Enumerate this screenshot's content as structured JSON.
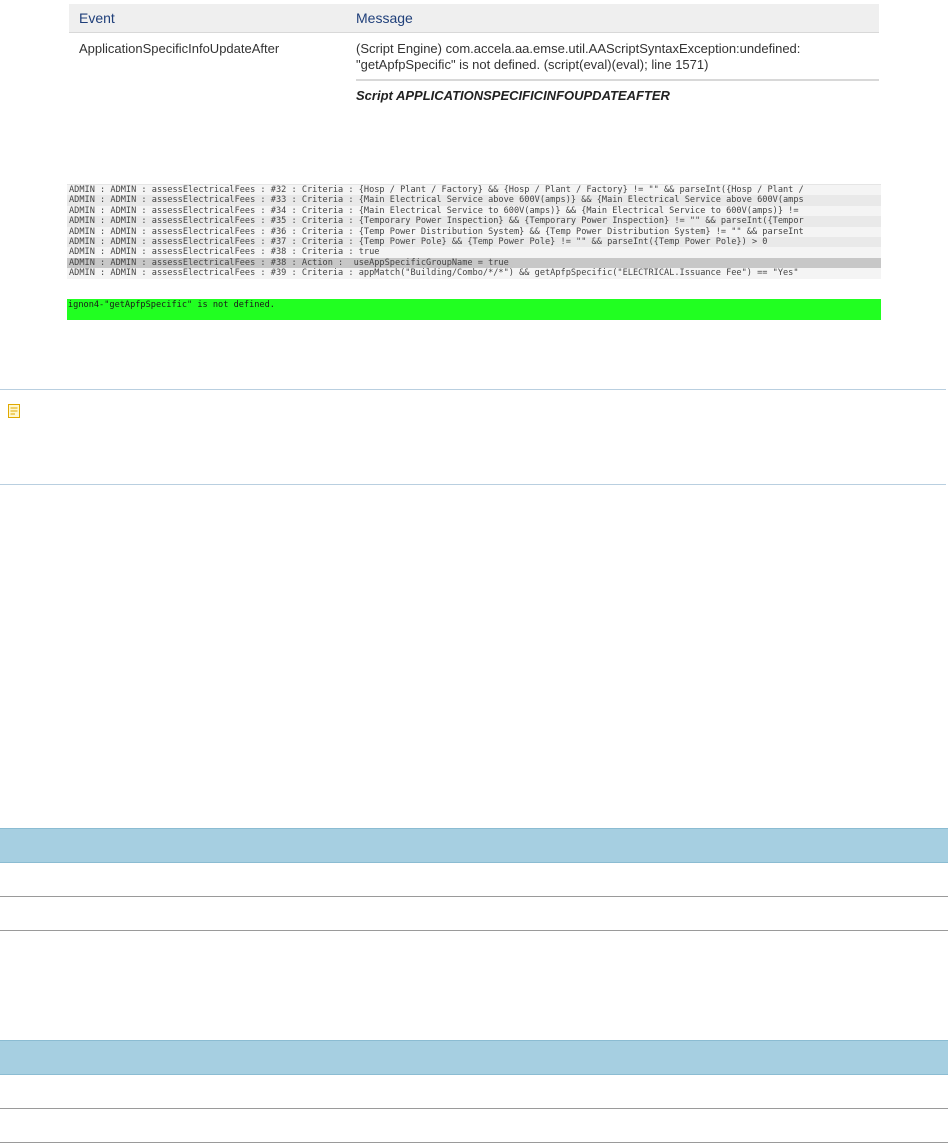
{
  "event_table": {
    "headers": {
      "event": "Event",
      "message": "Message"
    },
    "row": {
      "event": "ApplicationSpecificInfoUpdateAfter",
      "message_line1": "(Script Engine) com.accela.aa.emse.util.AAScriptSyntaxException:undefined:",
      "message_line2": "\"getApfpSpecific\" is not defined. (script(eval)(eval); line 1571)"
    },
    "script_label": "Script  APPLICATIONSPECIFICINFOUPDATEAFTER"
  },
  "console": {
    "lines": [
      "ADMIN : ADMIN : assessElectricalFees : #32 : Criteria : {Hosp / Plant / Factory} && {Hosp / Plant / Factory} != \"\" && parseInt({Hosp / Plant /",
      "ADMIN : ADMIN : assessElectricalFees : #33 : Criteria : {Main Electrical Service above 600V(amps)} && {Main Electrical Service above 600V(amps",
      "ADMIN : ADMIN : assessElectricalFees : #34 : Criteria : {Main Electrical Service to 600V(amps)} && {Main Electrical Service to 600V(amps)} !=",
      "ADMIN : ADMIN : assessElectricalFees : #35 : Criteria : {Temporary Power Inspection} && {Temporary Power Inspection} != \"\" && parseInt({Tempor",
      "ADMIN : ADMIN : assessElectricalFees : #36 : Criteria : {Temp Power Distribution System} && {Temp Power Distribution System} != \"\" && parseInt",
      "ADMIN : ADMIN : assessElectricalFees : #37 : Criteria : {Temp Power Pole} && {Temp Power Pole} != \"\" && parseInt({Temp Power Pole}) > 0",
      "ADMIN : ADMIN : assessElectricalFees : #38 : Criteria : true",
      "ADMIN : ADMIN : assessElectricalFees : #38 : Action :  useAppSpecificGroupName = true",
      "ADMIN : ADMIN : assessElectricalFees : #39 : Criteria : appMatch(\"Building/Combo/*/*\") && getApfpSpecific(\"ELECTRICAL.Issuance Fee\") == \"Yes\""
    ],
    "error": "ignon4-\"getApfpSpecific\" is not defined."
  },
  "note": {
    "icon": "note-icon"
  },
  "colors": {
    "console_error_bg": "#21ff21",
    "table_header_bg": "#a6cfe1"
  }
}
